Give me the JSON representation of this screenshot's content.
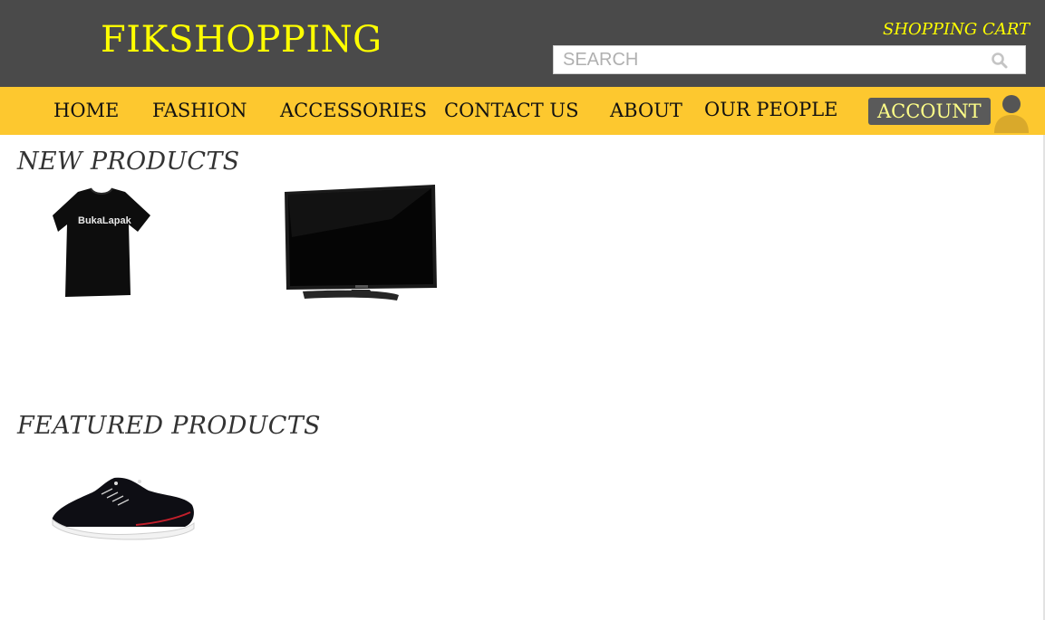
{
  "header": {
    "brand": "FIKSHOPPING",
    "cart_label": "SHOPPING CART",
    "search": {
      "placeholder": "SEARCH",
      "value": ""
    },
    "colors": {
      "header_bg": "#4a4a4a",
      "brand": "#ffff00"
    }
  },
  "nav": {
    "items": [
      {
        "label": "HOME"
      },
      {
        "label": "FASHION"
      },
      {
        "label": "ACCESSORIES"
      },
      {
        "label": "CONTACT US"
      },
      {
        "label": "ABOUT"
      },
      {
        "label": "OUR PEOPLE"
      }
    ],
    "account_label": "ACCOUNT",
    "colors": {
      "nav_bg": "#fdc82f",
      "account_bg": "#5a5a5a"
    }
  },
  "sections": {
    "new_products": {
      "title": "NEW PRODUCTS",
      "items": [
        {
          "icon": "tshirt-image",
          "shirt_text": "BukaLapak"
        },
        {
          "icon": "tv-monitor-image"
        }
      ]
    },
    "featured_products": {
      "title": "FEATURED PRODUCTS",
      "items": [
        {
          "icon": "sneaker-image"
        }
      ]
    }
  }
}
